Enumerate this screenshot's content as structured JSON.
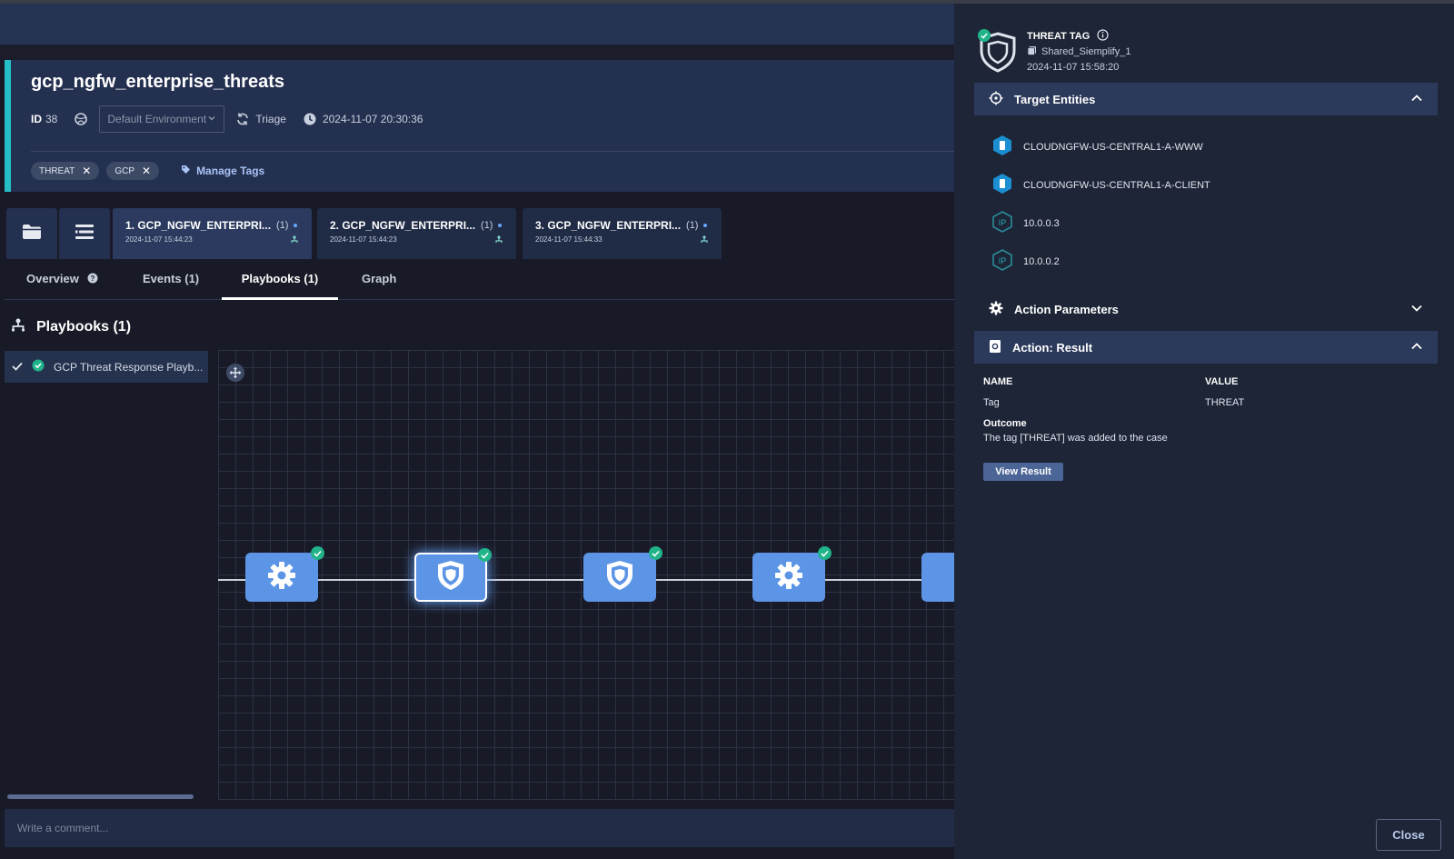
{
  "case": {
    "title": "gcp_ngfw_enterprise_threats",
    "id_label": "ID",
    "id_value": "38",
    "environment": "Default Environment",
    "stage": "Triage",
    "datetime": "2024-11-07 20:30:36",
    "tags": [
      "THREAT",
      "GCP"
    ],
    "manage_tags": "Manage Tags"
  },
  "case_tabs": [
    {
      "title": "1. GCP_NGFW_ENTERPRI...",
      "count": "(1)",
      "date": "2024-11-07 15:44:23"
    },
    {
      "title": "2. GCP_NGFW_ENTERPRI...",
      "count": "(1)",
      "date": "2024-11-07 15:44:23"
    },
    {
      "title": "3. GCP_NGFW_ENTERPRI...",
      "count": "(1)",
      "date": "2024-11-07 15:44:33"
    }
  ],
  "subtabs": {
    "overview": "Overview",
    "events": "Events (1)",
    "playbooks": "Playbooks (1)",
    "graph": "Graph"
  },
  "playbooks": {
    "heading": "Playbooks (1)",
    "item": "GCP Threat Response Playb..."
  },
  "comment": {
    "placeholder": "Write a comment..."
  },
  "panel": {
    "title": "THREAT TAG",
    "integration": "Shared_Siemplify_1",
    "date": "2024-11-07 15:58:20",
    "target_entities_label": "Target Entities",
    "entities": [
      {
        "type": "host",
        "name": "CLOUDNGFW-US-CENTRAL1-A-WWW"
      },
      {
        "type": "host",
        "name": "CLOUDNGFW-US-CENTRAL1-A-CLIENT"
      },
      {
        "type": "ip",
        "name": "10.0.0.3"
      },
      {
        "type": "ip",
        "name": "10.0.0.2"
      }
    ],
    "action_parameters_label": "Action Parameters",
    "action_result_label": "Action: Result",
    "name_header": "NAME",
    "value_header": "VALUE",
    "param_name": "Tag",
    "param_value": "THREAT",
    "outcome_label": "Outcome",
    "outcome_text": "The tag [THREAT] was added to the case",
    "view_result": "View Result",
    "close": "Close"
  },
  "colors": {
    "accent": "#26bfc7",
    "node": "#5d95e6",
    "success": "#21b48a",
    "panel_bg": "#1d2536"
  }
}
